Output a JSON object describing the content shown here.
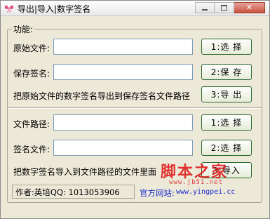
{
  "window": {
    "title": "导出|导入|数字签名",
    "icon": "butterfly-icon"
  },
  "group": {
    "title": "功能:"
  },
  "export": {
    "source_label": "原始文件:",
    "source_value": "",
    "select_button": "1:选 择",
    "save_label": "保存签名:",
    "save_value": "",
    "save_button": "2:保 存",
    "hint": "把原始文件的数字签名导出到保存签名文件路径",
    "export_button": "3:导 出"
  },
  "import": {
    "path_label": "文件路径:",
    "path_value": "",
    "path_button": "1:选 择",
    "sig_label": "签名文件:",
    "sig_value": "",
    "sig_button": "2:选 择",
    "hint": "把数字签名导入到文件路径的文件里面",
    "import_button": "3:导入"
  },
  "footer": {
    "author": "作者:英培QQ: 1013053906",
    "site_label": "官方网站:",
    "site_url": "www.yingpei.cc"
  },
  "watermark": {
    "brand": "脚本之家",
    "url": "www.jb51.net"
  },
  "colors": {
    "window_bg": "#ece9d8",
    "button_border": "#2f6a2f",
    "link": "#1a2bd0",
    "watermark": "#e02020"
  }
}
